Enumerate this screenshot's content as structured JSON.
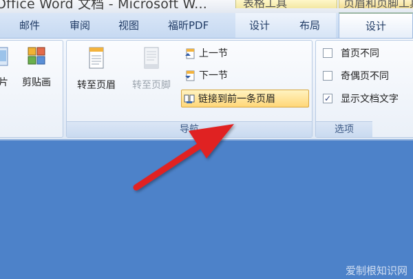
{
  "window": {
    "title": "Office Word 文档 - Microsoft W..."
  },
  "contextual": {
    "table_tools": "表格工具",
    "header_footer_tools": "页眉和页脚工具"
  },
  "tabs": [
    {
      "label": "邮件"
    },
    {
      "label": "审阅"
    },
    {
      "label": "视图"
    },
    {
      "label": "福昕PDF"
    },
    {
      "label": "设计"
    },
    {
      "label": "布局"
    },
    {
      "label": "设计"
    }
  ],
  "ribbon": {
    "insert_group": {
      "partial_label": "片",
      "clipart_label": "剪贴画"
    },
    "navigation": {
      "goto_header": "转至页眉",
      "goto_footer": "转至页脚",
      "prev_section": "上一节",
      "next_section": "下一节",
      "link_previous": "链接到前一条页眉",
      "group_label": "导航"
    },
    "options": {
      "different_first": {
        "label": "首页不同",
        "checked": false
      },
      "different_odd_even": {
        "label": "奇偶页不同",
        "checked": false
      },
      "show_doc_text": {
        "label": "显示文档文字",
        "checked": true
      },
      "group_label": "选项"
    }
  },
  "watermark": "爱制根知识网",
  "colors": {
    "document_bg": "#4d82c9",
    "arrow": "#e02020",
    "highlight": "#ffd778"
  }
}
